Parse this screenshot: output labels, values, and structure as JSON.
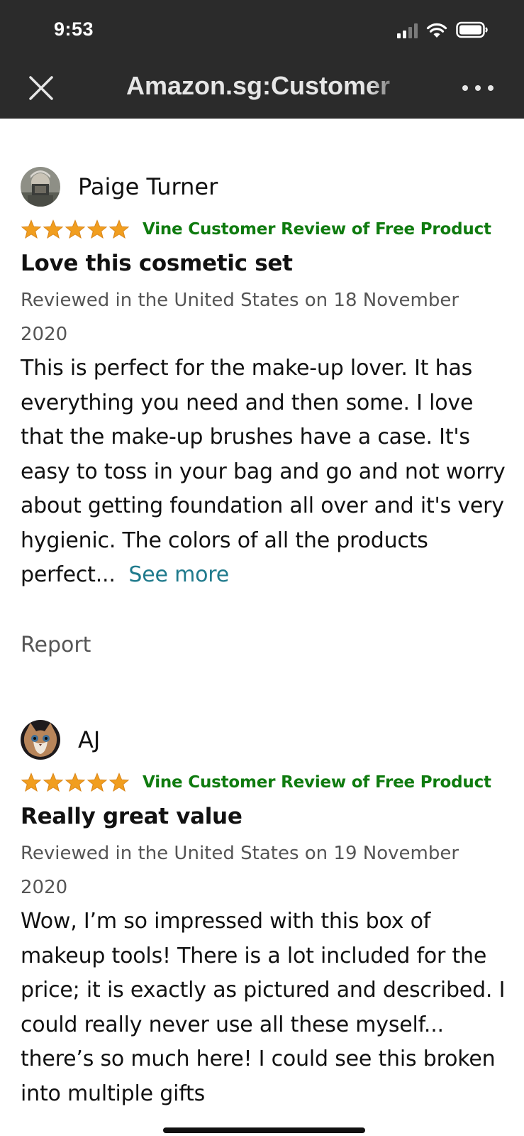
{
  "status_bar": {
    "time": "9:53"
  },
  "nav": {
    "title": "Amazon.sg:Customer",
    "close_icon": "close-icon",
    "more_icon": "more-dots-icon"
  },
  "colors": {
    "topbar_bg": "#2b2b2b",
    "vine_green": "#0f7b0f",
    "star_orange": "#f19e1f",
    "link_teal": "#1f7a8c",
    "meta_gray": "#555555"
  },
  "reviews": [
    {
      "reviewer": "Paige Turner",
      "rating": 5,
      "badge": "Vine Customer Review of Free Product",
      "title": "Love this cosmetic set",
      "date": "Reviewed in the United States on 18 November 2020",
      "body": "This is perfect for the make-up lover. It has everything you need and then some. I love that the make-up brushes have a case. It's easy to toss in your bag and go and not worry about getting foundation all over and it's very hygienic. The colors of all the products perfect...",
      "see_more": "See more",
      "report": "Report"
    },
    {
      "reviewer": "AJ",
      "rating": 5,
      "badge": "Vine Customer Review of Free Product",
      "title": "Really great value",
      "date": "Reviewed in the United States on 19 November 2020",
      "body": "Wow, I’m so impressed with this box of makeup tools! There is a lot included for the price; it is exactly as pictured and described. I could really never use all these myself... there’s so much here! I could see this broken into multiple gifts"
    }
  ]
}
